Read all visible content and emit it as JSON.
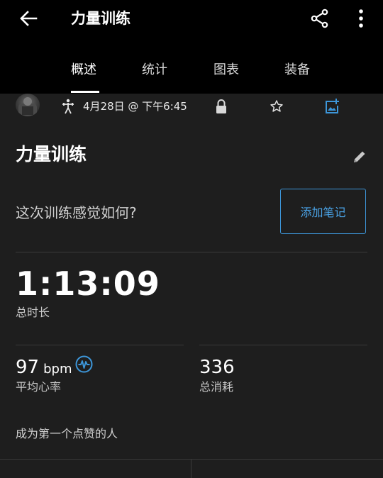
{
  "header": {
    "title": "力量训练",
    "icons": {
      "back": "arrow-left-icon",
      "share": "share-icon",
      "more": "more-vert-icon"
    }
  },
  "tabs": [
    {
      "label": "概述",
      "active": true
    },
    {
      "label": "统计",
      "active": false
    },
    {
      "label": "图表",
      "active": false
    },
    {
      "label": "装备",
      "active": false
    }
  ],
  "meta": {
    "date": "4月28日 @ 下午6:45",
    "icons": {
      "activity": "strength-training-icon",
      "privacy": "lock-icon",
      "favorite": "star-icon",
      "photo": "add-photo-icon"
    }
  },
  "activity": {
    "name": "力量训练",
    "feel_question": "这次训练感觉如何?",
    "add_note_label": "添加笔记"
  },
  "stats": {
    "duration": {
      "value": "1:13:09",
      "label": "总时长"
    },
    "heart_rate": {
      "value": "97",
      "unit": "bpm",
      "label": "平均心率"
    },
    "calories": {
      "value": "336",
      "label": "总消耗"
    }
  },
  "social": {
    "like_prompt": "成为第一个点赞的人"
  },
  "colors": {
    "accent": "#3d96d9",
    "background": "#1e1e1e",
    "appbar": "#000000"
  }
}
